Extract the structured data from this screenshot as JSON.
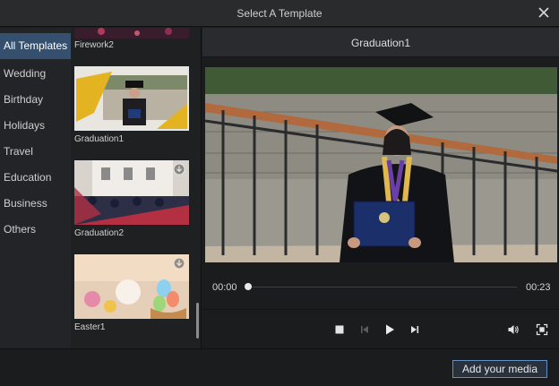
{
  "window": {
    "title": "Select A Template",
    "close_icon": "close-icon"
  },
  "categories": [
    {
      "label": "All Templates",
      "active": true
    },
    {
      "label": "Wedding",
      "active": false
    },
    {
      "label": "Birthday",
      "active": false
    },
    {
      "label": "Holidays",
      "active": false
    },
    {
      "label": "Travel",
      "active": false
    },
    {
      "label": "Education",
      "active": false
    },
    {
      "label": "Business",
      "active": false
    },
    {
      "label": "Others",
      "active": false
    }
  ],
  "templates": [
    {
      "name": "Firework2",
      "selected": false,
      "downloadable": false
    },
    {
      "name": "Graduation1",
      "selected": true,
      "downloadable": false
    },
    {
      "name": "Graduation2",
      "selected": false,
      "downloadable": true
    },
    {
      "name": "Easter1",
      "selected": false,
      "downloadable": true
    }
  ],
  "preview": {
    "title": "Graduation1",
    "current_time": "00:00",
    "duration": "00:23",
    "progress": 0.0
  },
  "controls": [
    "stop-icon",
    "previous-frame-icon",
    "play-icon",
    "next-frame-icon",
    "volume-icon",
    "fullscreen-icon"
  ],
  "footer": {
    "add_media_label": "Add your media"
  },
  "colors": {
    "accent": "#5f8fc6",
    "active_category": "#34506e"
  }
}
